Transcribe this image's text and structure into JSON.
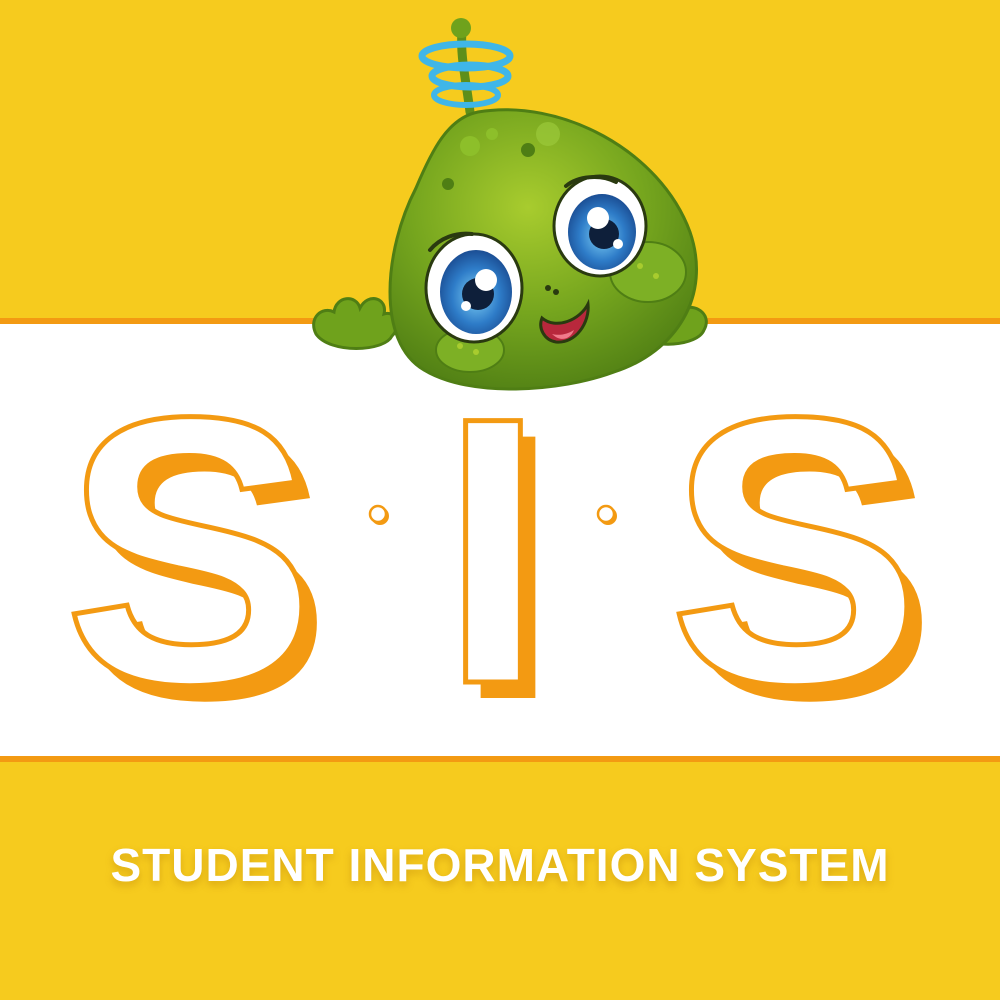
{
  "logo": {
    "letters": [
      "S",
      "I",
      "S"
    ],
    "tagline": "STUDENT INFORMATION SYSTEM"
  },
  "mascot": {
    "icon": "green-alien-mascot-icon"
  },
  "colors": {
    "background": "#F6CB1E",
    "band": "#FFFFFF",
    "accent_orange": "#F39A12",
    "mascot_green": "#6FA21C",
    "halo_blue": "#3FB6E8",
    "eye_blue": "#2E6FC0"
  }
}
